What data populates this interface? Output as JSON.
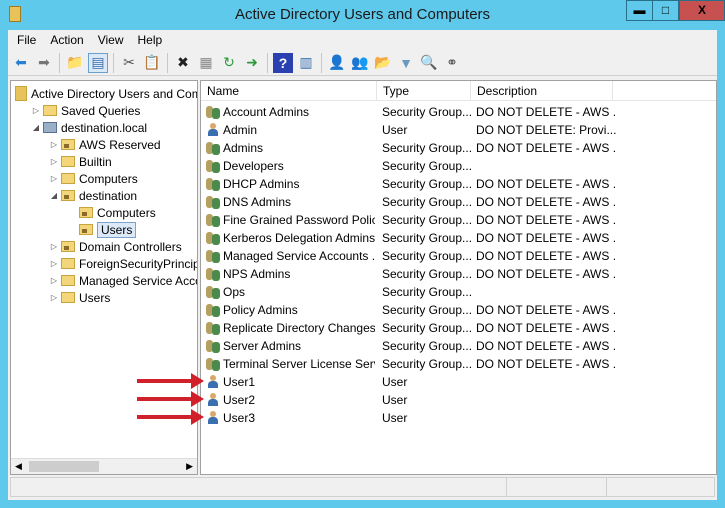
{
  "window": {
    "title": "Active Directory Users and Computers",
    "minimize": "▬",
    "maximize": "□",
    "close": "X"
  },
  "menu": [
    "File",
    "Action",
    "View",
    "Help"
  ],
  "toolbar": [
    {
      "name": "back",
      "glyph": "⬅",
      "color": "#2a7fd0"
    },
    {
      "name": "forward",
      "glyph": "➡",
      "color": "#777"
    },
    {
      "sep": true
    },
    {
      "name": "up-folder",
      "glyph": "📁",
      "color": "#c9a43e"
    },
    {
      "name": "show-hide-tree",
      "glyph": "▤",
      "color": "#3a6fb0",
      "active": true
    },
    {
      "sep": true
    },
    {
      "name": "cut",
      "glyph": "✂",
      "color": "#555"
    },
    {
      "name": "paste",
      "glyph": "📋",
      "color": "#555"
    },
    {
      "sep": true
    },
    {
      "name": "delete",
      "glyph": "✖",
      "color": "#222"
    },
    {
      "name": "properties",
      "glyph": "▦",
      "color": "#888"
    },
    {
      "name": "refresh",
      "glyph": "↻",
      "color": "#2a9a3a"
    },
    {
      "name": "export",
      "glyph": "➜",
      "color": "#2a9a3a"
    },
    {
      "sep": true
    },
    {
      "name": "help",
      "glyph": "?",
      "color": "#fff",
      "bg": "#2a3fb0"
    },
    {
      "name": "action-pane",
      "glyph": "▥",
      "color": "#3a6fb0"
    },
    {
      "sep": true
    },
    {
      "name": "new-user",
      "glyph": "👤",
      "color": "#3a6fb0"
    },
    {
      "name": "new-group",
      "glyph": "👥",
      "color": "#4c8a4c"
    },
    {
      "name": "new-ou",
      "glyph": "📂",
      "color": "#c9a43e"
    },
    {
      "name": "filter",
      "glyph": "▼",
      "color": "#6a9ac0"
    },
    {
      "name": "find",
      "glyph": "🔍",
      "color": "#c9a43e"
    },
    {
      "name": "add-to-group",
      "glyph": "⚭",
      "color": "#555"
    }
  ],
  "tree": [
    {
      "label": "Active Directory Users and Com",
      "level": 0,
      "exp": "",
      "icon": "root"
    },
    {
      "label": "Saved Queries",
      "level": 1,
      "exp": "▷",
      "icon": "folder"
    },
    {
      "label": "destination.local",
      "level": 1,
      "exp": "◢",
      "icon": "domain"
    },
    {
      "label": "AWS Reserved",
      "level": 2,
      "exp": "▷",
      "icon": "ou"
    },
    {
      "label": "Builtin",
      "level": 2,
      "exp": "▷",
      "icon": "folder"
    },
    {
      "label": "Computers",
      "level": 2,
      "exp": "▷",
      "icon": "folder"
    },
    {
      "label": "destination",
      "level": 2,
      "exp": "◢",
      "icon": "ou"
    },
    {
      "label": "Computers",
      "level": 3,
      "exp": "",
      "icon": "ou"
    },
    {
      "label": "Users",
      "level": 3,
      "exp": "",
      "icon": "ou",
      "selected": true
    },
    {
      "label": "Domain Controllers",
      "level": 2,
      "exp": "▷",
      "icon": "ou"
    },
    {
      "label": "ForeignSecurityPrincipals",
      "level": 2,
      "exp": "▷",
      "icon": "folder"
    },
    {
      "label": "Managed Service Accoun",
      "level": 2,
      "exp": "▷",
      "icon": "folder"
    },
    {
      "label": "Users",
      "level": 2,
      "exp": "▷",
      "icon": "folder"
    }
  ],
  "columns": [
    "Name",
    "Type",
    "Description"
  ],
  "rows": [
    {
      "name": "Account Admins",
      "type": "Security Group...",
      "desc": "DO NOT DELETE - AWS ...",
      "kind": "group"
    },
    {
      "name": "Admin",
      "type": "User",
      "desc": "DO NOT DELETE:  Provi...",
      "kind": "user"
    },
    {
      "name": "Admins",
      "type": "Security Group...",
      "desc": "DO NOT DELETE - AWS ...",
      "kind": "group"
    },
    {
      "name": "Developers",
      "type": "Security Group...",
      "desc": "",
      "kind": "group"
    },
    {
      "name": "DHCP Admins",
      "type": "Security Group...",
      "desc": "DO NOT DELETE - AWS ...",
      "kind": "group"
    },
    {
      "name": "DNS Admins",
      "type": "Security Group...",
      "desc": "DO NOT DELETE - AWS ...",
      "kind": "group"
    },
    {
      "name": "Fine Grained Password Polic...",
      "type": "Security Group...",
      "desc": "DO NOT DELETE - AWS ...",
      "kind": "group"
    },
    {
      "name": "Kerberos Delegation Admins",
      "type": "Security Group...",
      "desc": "DO NOT DELETE - AWS ...",
      "kind": "group"
    },
    {
      "name": "Managed Service Accounts ...",
      "type": "Security Group...",
      "desc": "DO NOT DELETE - AWS ...",
      "kind": "group"
    },
    {
      "name": "NPS Admins",
      "type": "Security Group...",
      "desc": "DO NOT DELETE - AWS ...",
      "kind": "group"
    },
    {
      "name": "Ops",
      "type": "Security Group...",
      "desc": "",
      "kind": "group"
    },
    {
      "name": "Policy Admins",
      "type": "Security Group...",
      "desc": "DO NOT DELETE - AWS ...",
      "kind": "group"
    },
    {
      "name": "Replicate Directory Changes ...",
      "type": "Security Group...",
      "desc": "DO NOT DELETE - AWS ...",
      "kind": "group"
    },
    {
      "name": "Server Admins",
      "type": "Security Group...",
      "desc": "DO NOT DELETE - AWS ...",
      "kind": "group"
    },
    {
      "name": "Terminal Server License Serv...",
      "type": "Security Group...",
      "desc": "DO NOT DELETE - AWS ...",
      "kind": "group"
    },
    {
      "name": "User1",
      "type": "User",
      "desc": "",
      "kind": "user",
      "arrow": true
    },
    {
      "name": "User2",
      "type": "User",
      "desc": "",
      "kind": "user",
      "arrow": true
    },
    {
      "name": "User3",
      "type": "User",
      "desc": "",
      "kind": "user",
      "arrow": true
    }
  ]
}
